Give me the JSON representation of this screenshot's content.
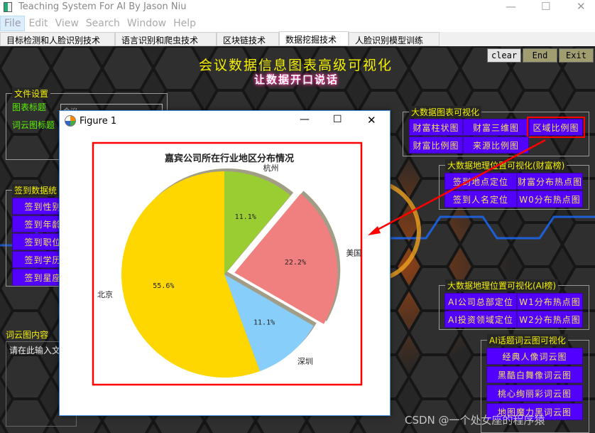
{
  "window": {
    "title": "Teaching System For AI By Jason Niu"
  },
  "menu": [
    "File",
    "Edit",
    "View",
    "Search",
    "Window",
    "Help"
  ],
  "tabs": [
    "目标检测和人脸识别技术",
    "语言识别和爬虫技术",
    "区块链技术",
    "数据挖掘技术",
    "人脸识别模型训练"
  ],
  "selected_tab": "数据挖掘技术",
  "header": {
    "title": "会议数据信息图表高级可视化",
    "subtitle": "让数据开口说话"
  },
  "top_buttons": {
    "clear": "clear",
    "end": "End",
    "exit": "Exit"
  },
  "file_settings": {
    "title": "文件设置",
    "chart_title_label": "图表标题",
    "chart_title_value": "会议",
    "wordcloud_title_label": "词云图标题"
  },
  "signin": {
    "title": "签到数据统",
    "buttons": [
      "签到性别比",
      "签到年龄比",
      "签到职位比",
      "签到学历比",
      "签到星座比"
    ]
  },
  "wordcloud_content": {
    "label": "词云图内容",
    "placeholder": "请在此输入文"
  },
  "bigdata_chart": {
    "title": "大数据图表可视化",
    "buttons": [
      "财富柱状图",
      "财富三维图",
      "区域比例图",
      "财富比例图",
      "来源比例图"
    ]
  },
  "geo_wealth": {
    "title": "大数据地理位置可视化(财富榜)",
    "buttons": [
      "签到地点定位",
      "财富分布热点图",
      "签到人名定位",
      "W0分布热点图"
    ]
  },
  "geo_ai": {
    "title": "大数据地理位置可视化(AI榜)",
    "buttons": [
      "AI公司总部定位",
      "W1分布热点图",
      "AI投资领域定位",
      "W2分布热点图"
    ]
  },
  "ai_wordcloud": {
    "title": "AI话题词云图可视化",
    "buttons": [
      "经典人像词云图",
      "黑酷白舞像词云图",
      "桃心绚丽彩词云图",
      "地图魔力黑词云图"
    ]
  },
  "figure": {
    "window_title": "Figure 1"
  },
  "chart_data": {
    "type": "pie",
    "title": "嘉宾公司所在行业地区分布情况",
    "categories": [
      "杭州",
      "美国",
      "深圳",
      "北京"
    ],
    "values": [
      11.1,
      22.2,
      11.1,
      55.6
    ],
    "labels": [
      "11.1%",
      "22.2%",
      "11.1%",
      "55.6%"
    ],
    "colors": [
      "#9acd32",
      "#f08080",
      "#87cefa",
      "#ffd700"
    ],
    "explode": [
      0,
      0.1,
      0,
      0
    ],
    "shadow": true,
    "startangle": 90
  },
  "highlight_color": "#ff0000",
  "watermark": "CSDN @一个处女座的程序猿"
}
